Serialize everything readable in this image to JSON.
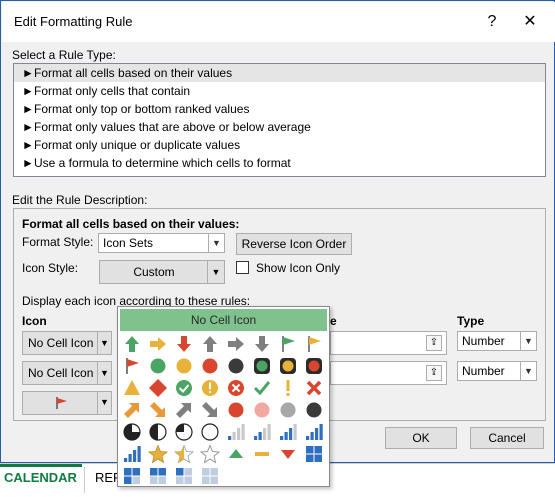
{
  "window": {
    "title": "Edit Formatting Rule",
    "help_glyph": "?",
    "close_glyph": "✕"
  },
  "rule_type": {
    "label": "Select a Rule Type:",
    "items": [
      "Format all cells based on their values",
      "Format only cells that contain",
      "Format only top or bottom ranked values",
      "Format only values that are above or below average",
      "Format only unique or duplicate values",
      "Use a formula to determine which cells to format"
    ],
    "selected_index": 0,
    "item_glyph": "►"
  },
  "description": {
    "label": "Edit the Rule Description:",
    "heading": "Format all cells based on their values:",
    "format_style_label": "Format Style:",
    "format_style_value": "Icon Sets",
    "reverse_button": "Reverse Icon Order",
    "icon_style_label": "Icon Style:",
    "icon_style_value": "Custom",
    "show_icon_only_label": "Show Icon Only",
    "display_rules_label": "Display each icon according to these rules:",
    "icon_col_header": "Icon",
    "value_col_header": "e",
    "type_col_header": "Type",
    "icon_rows": [
      {
        "value": "No Cell Icon",
        "type": "Number"
      },
      {
        "value": "No Cell Icon",
        "type": "Number"
      },
      {
        "value": "",
        "type": ""
      }
    ]
  },
  "icon_picker": {
    "header": "No Cell Icon",
    "icon_names": [
      "green-up-arrow",
      "yellow-side-arrow",
      "red-down-arrow",
      "gray-up-arrow",
      "gray-right-arrow",
      "gray-down-arrow",
      "green-flag",
      "yellow-flag",
      "red-flag",
      "green-circle",
      "yellow-circle",
      "red-circle",
      "black-circle",
      "green-traffic-light",
      "yellow-traffic-light",
      "red-traffic-light",
      "yellow-triangle",
      "red-diamond",
      "green-check-circle",
      "yellow-exclamation-circle",
      "red-x-circle",
      "green-check",
      "yellow-exclamation",
      "red-x",
      "orange-up-right-arrow",
      "orange-down-right-arrow",
      "gray-up-right-arrow",
      "gray-down-right-arrow",
      "red-dot",
      "pink-dot",
      "gray-dot",
      "black-dot",
      "quarter-pie",
      "half-pie",
      "three-quarter-pie",
      "empty-circle",
      "signal-bars-1",
      "signal-bars-2",
      "signal-bars-3",
      "signal-bars-4",
      "signal-bars-full",
      "gold-star",
      "half-star",
      "empty-star",
      "green-up-triangle",
      "yellow-dash",
      "red-down-triangle",
      "four-box-full",
      "three-box",
      "two-box",
      "one-box",
      "zero-box"
    ]
  },
  "buttons": {
    "ok": "OK",
    "cancel": "Cancel"
  },
  "taskbar": {
    "tab_calendar": "CALENDAR",
    "tab_rep": "REP"
  },
  "colors": {
    "green": "#4aa564",
    "yellow": "#e8b13a",
    "red": "#d9462f",
    "gray": "#7f7f7f",
    "accent_green": "#107c41",
    "window_border": "#1f5fae"
  }
}
